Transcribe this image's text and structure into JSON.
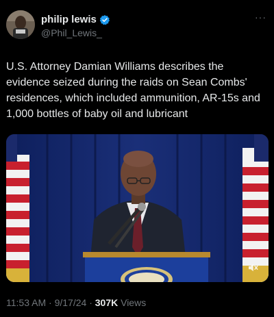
{
  "author": {
    "display_name": "philip lewis",
    "handle": "@Phil_Lewis_",
    "verified_icon": "verified-badge-icon",
    "avatar_icon": "profile-avatar"
  },
  "menu": {
    "more_label": "···"
  },
  "tweet": {
    "text": "U.S. Attorney Damian Williams describes the evidence seized during the raids on Sean Combs' residences, which included ammunition, AR-15s and 1,000 bottles of baby oil and lubricant"
  },
  "media": {
    "type": "video",
    "mute_icon": "speaker-muted-icon"
  },
  "meta": {
    "time": "11:53 AM",
    "separator": "·",
    "date": "9/17/24",
    "views_count": "307K",
    "views_label": "Views"
  },
  "colors": {
    "background": "#000000",
    "text_primary": "#e7e9ea",
    "text_secondary": "#71767b",
    "verified_blue": "#1d9bf0"
  }
}
